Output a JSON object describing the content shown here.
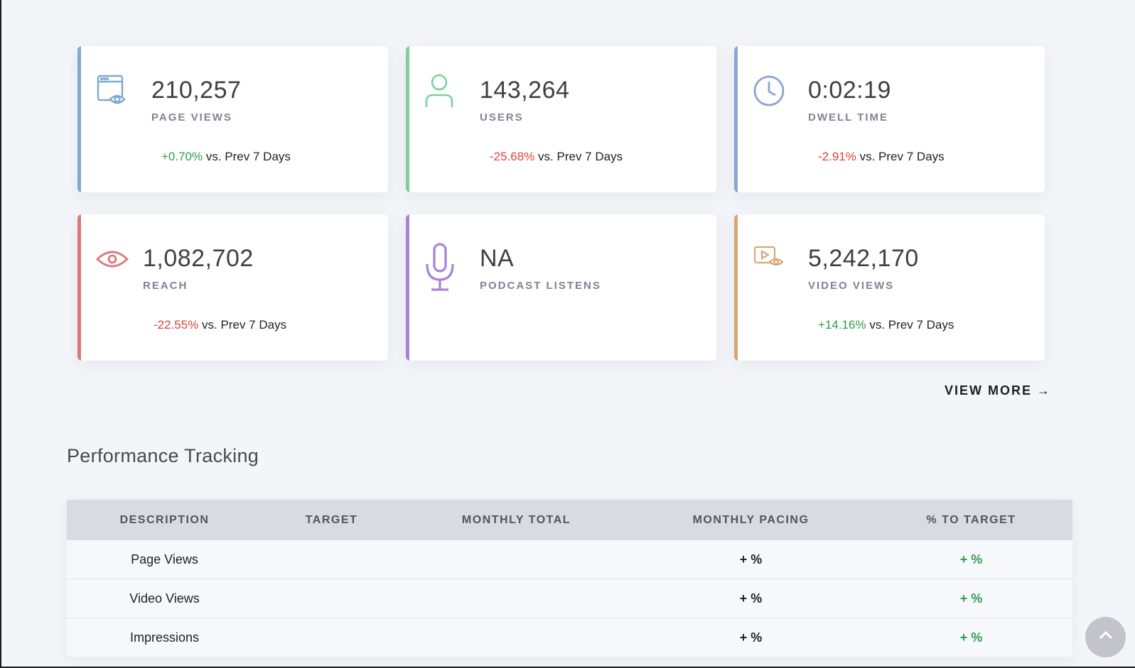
{
  "cards": [
    {
      "value": "210,257",
      "label": "PAGE VIEWS",
      "change": "+0.70%",
      "change_suffix": " vs. Prev 7 Days",
      "trend": "up",
      "accent": "#7fa9cf",
      "icon": "browser-eye-icon"
    },
    {
      "value": "143,264",
      "label": "USERS",
      "change": "-25.68%",
      "change_suffix": " vs. Prev 7 Days",
      "trend": "down",
      "accent": "#7fcf9e",
      "icon": "user-icon"
    },
    {
      "value": "0:02:19",
      "label": "DWELL TIME",
      "change": "-2.91%",
      "change_suffix": " vs. Prev 7 Days",
      "trend": "down",
      "accent": "#8ea3d6",
      "icon": "clock-icon"
    },
    {
      "value": "1,082,702",
      "label": "REACH",
      "change": "-22.55%",
      "change_suffix": " vs. Prev 7 Days",
      "trend": "down",
      "accent": "#d97a7a",
      "icon": "eye-icon"
    },
    {
      "value": "NA",
      "label": "PODCAST LISTENS",
      "change": "",
      "change_suffix": "",
      "trend": "none",
      "accent": "#a983d6",
      "icon": "microphone-icon"
    },
    {
      "value": "5,242,170",
      "label": "VIDEO VIEWS",
      "change": "+14.16%",
      "change_suffix": " vs. Prev 7 Days",
      "trend": "up",
      "accent": "#d9a777",
      "icon": "video-eye-icon"
    }
  ],
  "view_more": "VIEW MORE →",
  "section_title": "Performance Tracking",
  "table": {
    "headers": [
      "DESCRIPTION",
      "TARGET",
      "MONTHLY TOTAL",
      "MONTHLY PACING",
      "% TO TARGET"
    ],
    "rows": [
      {
        "description": "Page Views",
        "target": "",
        "monthly_total": "",
        "monthly_pacing": "+ %",
        "pct_to_target": "+ %"
      },
      {
        "description": "Video Views",
        "target": "",
        "monthly_total": "",
        "monthly_pacing": "+ %",
        "pct_to_target": "+ %"
      },
      {
        "description": "Impressions",
        "target": "",
        "monthly_total": "",
        "monthly_pacing": "+ %",
        "pct_to_target": "+ %"
      }
    ]
  },
  "colors": {
    "positive": "#2e9e4f",
    "negative": "#e0433c"
  }
}
